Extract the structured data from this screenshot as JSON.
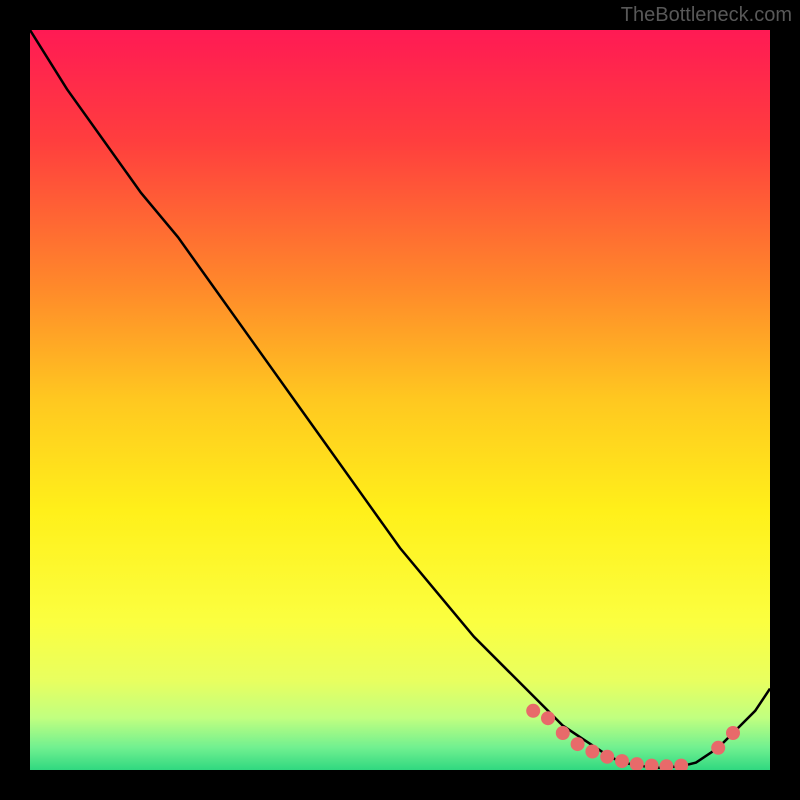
{
  "watermark": "TheBottleneck.com",
  "chart_data": {
    "type": "line",
    "title": "",
    "xlabel": "",
    "ylabel": "",
    "xlim": [
      0,
      100
    ],
    "ylim": [
      0,
      100
    ],
    "series": [
      {
        "name": "curve",
        "x": [
          0,
          5,
          10,
          15,
          20,
          25,
          30,
          35,
          40,
          45,
          50,
          55,
          60,
          65,
          70,
          72,
          75,
          78,
          80,
          83,
          85,
          88,
          90,
          93,
          95,
          98,
          100
        ],
        "y": [
          100,
          92,
          85,
          78,
          72,
          65,
          58,
          51,
          44,
          37,
          30,
          24,
          18,
          13,
          8,
          6,
          4,
          2,
          1,
          0.5,
          0.3,
          0.5,
          1,
          3,
          5,
          8,
          11
        ]
      }
    ],
    "markers": {
      "name": "highlight-points",
      "x": [
        68,
        70,
        72,
        74,
        76,
        78,
        80,
        82,
        84,
        86,
        88,
        93,
        95
      ],
      "y": [
        8,
        7,
        5,
        3.5,
        2.5,
        1.8,
        1.2,
        0.8,
        0.6,
        0.5,
        0.6,
        3,
        5
      ]
    },
    "gradient_stops": [
      {
        "offset": 0,
        "color": "#ff1a54"
      },
      {
        "offset": 15,
        "color": "#ff3e3e"
      },
      {
        "offset": 35,
        "color": "#ff8a2a"
      },
      {
        "offset": 50,
        "color": "#ffc820"
      },
      {
        "offset": 65,
        "color": "#fff01a"
      },
      {
        "offset": 80,
        "color": "#fbff40"
      },
      {
        "offset": 88,
        "color": "#e8ff60"
      },
      {
        "offset": 93,
        "color": "#c0ff80"
      },
      {
        "offset": 97,
        "color": "#70f090"
      },
      {
        "offset": 100,
        "color": "#30d880"
      }
    ]
  }
}
